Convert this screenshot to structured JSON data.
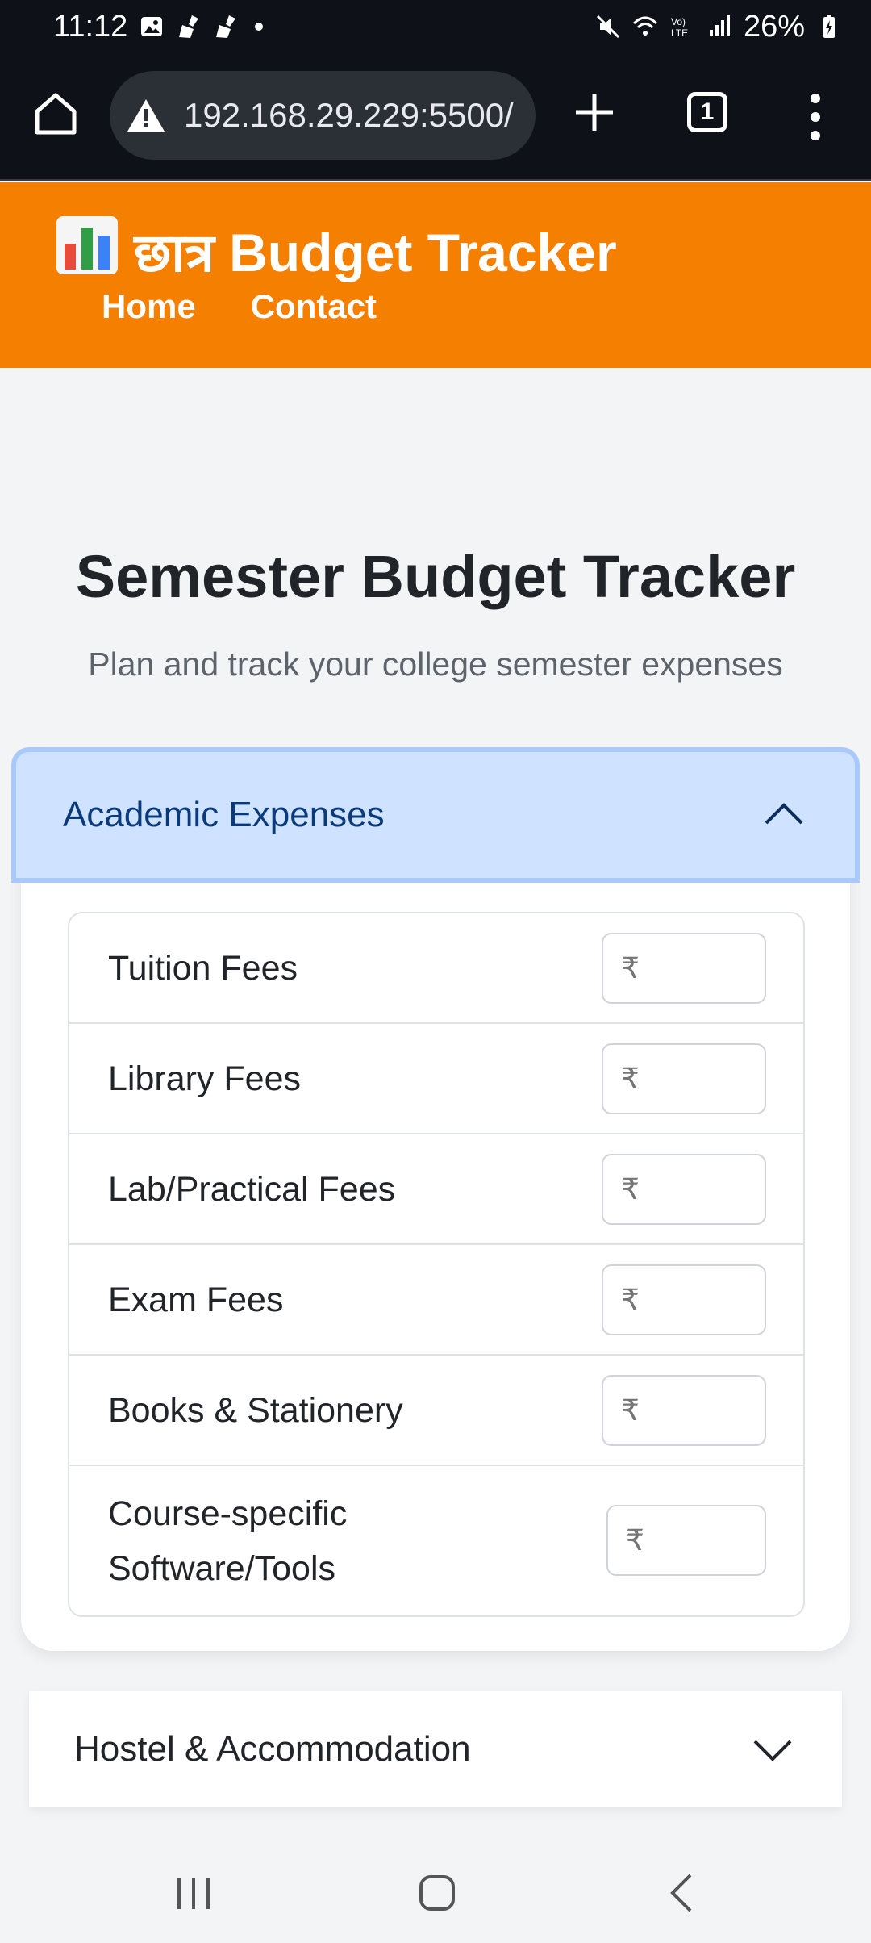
{
  "status_bar": {
    "time": "11:12",
    "battery": "26%",
    "icons": [
      "image-icon",
      "broom-icon",
      "broom-icon",
      "dot-icon",
      "mute-icon",
      "wifi-icon",
      "volte-icon",
      "signal-icon",
      "battery-charging-icon"
    ]
  },
  "browser": {
    "url": "192.168.29.229:5500/",
    "tab_count": "1"
  },
  "site": {
    "brand_hindi": "छात्र",
    "brand_name": "Budget Tracker",
    "nav": [
      "Home",
      "Contact"
    ],
    "accent_color": "#f57f00"
  },
  "main": {
    "title": "Semester Budget Tracker",
    "subtitle": "Plan and track your college semester expenses"
  },
  "sections": [
    {
      "title": "Academic Expenses",
      "expanded": true,
      "items": [
        {
          "label": "Tuition Fees",
          "placeholder": "₹"
        },
        {
          "label": "Library Fees",
          "placeholder": "₹"
        },
        {
          "label": "Lab/Practical Fees",
          "placeholder": "₹"
        },
        {
          "label": "Exam Fees",
          "placeholder": "₹"
        },
        {
          "label": "Books & Stationery",
          "placeholder": "₹"
        },
        {
          "label": "Course-specific Software/Tools",
          "placeholder": "₹"
        }
      ]
    },
    {
      "title": "Hostel & Accommodation",
      "expanded": false
    }
  ]
}
